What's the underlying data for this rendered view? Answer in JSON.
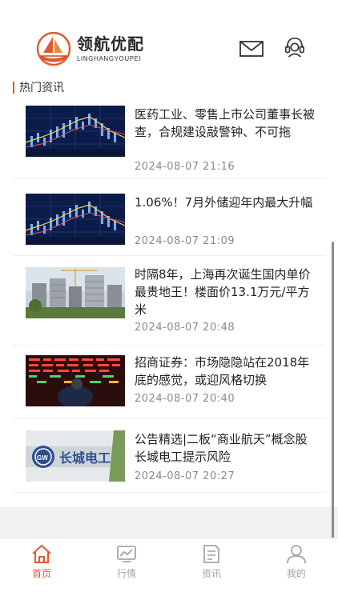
{
  "header": {
    "logo_name": "领航优配",
    "logo_sub": "LINGHANGYOUPEI",
    "icons": [
      "mail-icon",
      "customer-service-icon"
    ]
  },
  "section": {
    "title": "热门资讯"
  },
  "news": [
    {
      "title": "医药工业、零售上市公司董事长被查，合规建设敲警钟、不可拖",
      "time": "2024-08-07 21:16",
      "thumb": "stock-chart-image"
    },
    {
      "title": "1.06%！7月外储迎年内最大升幅",
      "time": "2024-08-07 21:09",
      "thumb": "stock-chart-image"
    },
    {
      "title": "时隔8年，上海再次诞生国内单价最贵地王！楼面价13.1万元/平方米",
      "time": "2024-08-07 20:48",
      "thumb": "construction-site-image"
    },
    {
      "title": "招商证券：市场隐隐站在2018年底的感觉，或迎风格切换",
      "time": "2024-08-07 20:40",
      "thumb": "trading-board-image"
    },
    {
      "title": "公告精选|二板“商业航天”概念股长城电工提示风险",
      "time": "2024-08-07 20:27",
      "thumb": "company-sign-image"
    }
  ],
  "tabs": [
    {
      "label": "首页",
      "icon": "home-icon",
      "active": true
    },
    {
      "label": "行情",
      "icon": "market-chart-icon",
      "active": false
    },
    {
      "label": "资讯",
      "icon": "news-document-icon",
      "active": false
    },
    {
      "label": "我的",
      "icon": "user-icon",
      "active": false
    }
  ],
  "colors": {
    "accent": "#e3582b",
    "text": "#222222",
    "muted": "#8a8a8a",
    "tab_inactive": "#a5a5a5"
  }
}
